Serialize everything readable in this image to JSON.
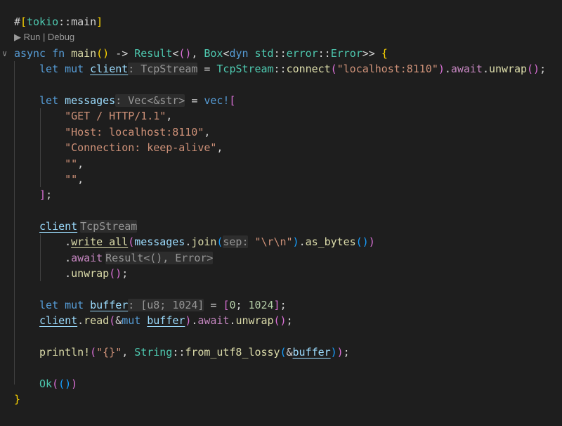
{
  "codelens": {
    "run": "Run",
    "sep": "|",
    "debug": "Debug"
  },
  "lines": [
    {
      "i": 0,
      "tokens": [
        {
          "c": "p",
          "t": "#"
        },
        {
          "c": "b1",
          "t": "["
        },
        {
          "c": "t",
          "t": "tokio"
        },
        {
          "c": "p",
          "t": "::"
        },
        {
          "c": "p",
          "t": "main"
        },
        {
          "c": "b1",
          "t": "]"
        }
      ]
    },
    {
      "lens": true
    },
    {
      "i": 0,
      "fold": true,
      "tokens": [
        {
          "c": "k",
          "t": "async"
        },
        {
          "c": "p",
          "t": " "
        },
        {
          "c": "k",
          "t": "fn"
        },
        {
          "c": "p",
          "t": " "
        },
        {
          "c": "f",
          "t": "main"
        },
        {
          "c": "b1",
          "t": "()"
        },
        {
          "c": "p",
          "t": " -> "
        },
        {
          "c": "t",
          "t": "Result"
        },
        {
          "c": "p",
          "t": "<"
        },
        {
          "c": "b2",
          "t": "()"
        },
        {
          "c": "p",
          "t": ", "
        },
        {
          "c": "t",
          "t": "Box"
        },
        {
          "c": "p",
          "t": "<"
        },
        {
          "c": "k",
          "t": "dyn"
        },
        {
          "c": "p",
          "t": " "
        },
        {
          "c": "t",
          "t": "std"
        },
        {
          "c": "p",
          "t": "::"
        },
        {
          "c": "t",
          "t": "error"
        },
        {
          "c": "p",
          "t": "::"
        },
        {
          "c": "t",
          "t": "Error"
        },
        {
          "c": "p",
          "t": ">> "
        },
        {
          "c": "b1",
          "t": "{"
        }
      ]
    },
    {
      "i": 4,
      "tokens": [
        {
          "c": "k",
          "t": "let"
        },
        {
          "c": "p",
          "t": " "
        },
        {
          "c": "k",
          "t": "mut"
        },
        {
          "c": "p",
          "t": " "
        },
        {
          "c": "v u",
          "t": "client"
        },
        {
          "c": "h",
          "t": ": TcpStream"
        },
        {
          "c": "p",
          "t": " = "
        },
        {
          "c": "t",
          "t": "TcpStream"
        },
        {
          "c": "p",
          "t": "::"
        },
        {
          "c": "f",
          "t": "connect"
        },
        {
          "c": "b2",
          "t": "("
        },
        {
          "c": "s",
          "t": "\"localhost:8110\""
        },
        {
          "c": "b2",
          "t": ")"
        },
        {
          "c": "p",
          "t": "."
        },
        {
          "c": "c",
          "t": "await"
        },
        {
          "c": "p",
          "t": "."
        },
        {
          "c": "f",
          "t": "unwrap"
        },
        {
          "c": "b2",
          "t": "()"
        },
        {
          "c": "p",
          "t": ";"
        }
      ]
    },
    {
      "i": 0,
      "tokens": []
    },
    {
      "i": 4,
      "tokens": [
        {
          "c": "k",
          "t": "let"
        },
        {
          "c": "p",
          "t": " "
        },
        {
          "c": "v",
          "t": "messages"
        },
        {
          "c": "h",
          "t": ": Vec<&str>"
        },
        {
          "c": "p",
          "t": " = "
        },
        {
          "c": "k",
          "t": "vec!"
        },
        {
          "c": "b2",
          "t": "["
        }
      ]
    },
    {
      "i": 8,
      "tokens": [
        {
          "c": "s",
          "t": "\"GET / HTTP/1.1\""
        },
        {
          "c": "p",
          "t": ","
        }
      ]
    },
    {
      "i": 8,
      "tokens": [
        {
          "c": "s",
          "t": "\"Host: localhost:8110\""
        },
        {
          "c": "p",
          "t": ","
        }
      ]
    },
    {
      "i": 8,
      "tokens": [
        {
          "c": "s",
          "t": "\"Connection: keep-alive\""
        },
        {
          "c": "p",
          "t": ","
        }
      ]
    },
    {
      "i": 8,
      "tokens": [
        {
          "c": "s",
          "t": "\"\""
        },
        {
          "c": "p",
          "t": ","
        }
      ]
    },
    {
      "i": 8,
      "tokens": [
        {
          "c": "s",
          "t": "\"\""
        },
        {
          "c": "p",
          "t": ","
        }
      ]
    },
    {
      "i": 4,
      "tokens": [
        {
          "c": "b2",
          "t": "]"
        },
        {
          "c": "p",
          "t": ";"
        }
      ]
    },
    {
      "i": 0,
      "tokens": []
    },
    {
      "i": 4,
      "tokens": [
        {
          "c": "v u",
          "t": "client"
        },
        {
          "c": "h hg",
          "t": "TcpStream"
        }
      ]
    },
    {
      "i": 8,
      "tokens": [
        {
          "c": "p",
          "t": "."
        },
        {
          "c": "f u",
          "t": "write_all"
        },
        {
          "c": "b2",
          "t": "("
        },
        {
          "c": "v",
          "t": "messages"
        },
        {
          "c": "p",
          "t": "."
        },
        {
          "c": "f",
          "t": "join"
        },
        {
          "c": "b3",
          "t": "("
        },
        {
          "c": "h",
          "t": "sep:"
        },
        {
          "c": "p",
          "t": " "
        },
        {
          "c": "s",
          "t": "\"\\r\\n\""
        },
        {
          "c": "b3",
          "t": ")"
        },
        {
          "c": "p",
          "t": "."
        },
        {
          "c": "f",
          "t": "as_bytes"
        },
        {
          "c": "b3",
          "t": "()"
        },
        {
          "c": "b2",
          "t": ")"
        }
      ]
    },
    {
      "i": 8,
      "tokens": [
        {
          "c": "p",
          "t": "."
        },
        {
          "c": "c",
          "t": "await"
        },
        {
          "c": "h hg",
          "t": "Result<(), Error>"
        }
      ]
    },
    {
      "i": 8,
      "tokens": [
        {
          "c": "p",
          "t": "."
        },
        {
          "c": "f",
          "t": "unwrap"
        },
        {
          "c": "b2",
          "t": "()"
        },
        {
          "c": "p",
          "t": ";"
        }
      ]
    },
    {
      "i": 0,
      "tokens": []
    },
    {
      "i": 4,
      "tokens": [
        {
          "c": "k",
          "t": "let"
        },
        {
          "c": "p",
          "t": " "
        },
        {
          "c": "k",
          "t": "mut"
        },
        {
          "c": "p",
          "t": " "
        },
        {
          "c": "v u",
          "t": "buffer"
        },
        {
          "c": "h",
          "t": ": [u8; 1024]"
        },
        {
          "c": "p",
          "t": " = "
        },
        {
          "c": "b2",
          "t": "["
        },
        {
          "c": "n",
          "t": "0"
        },
        {
          "c": "p",
          "t": "; "
        },
        {
          "c": "n",
          "t": "1024"
        },
        {
          "c": "b2",
          "t": "]"
        },
        {
          "c": "p",
          "t": ";"
        }
      ]
    },
    {
      "i": 4,
      "tokens": [
        {
          "c": "v u",
          "t": "client"
        },
        {
          "c": "p",
          "t": "."
        },
        {
          "c": "f",
          "t": "read"
        },
        {
          "c": "b2",
          "t": "("
        },
        {
          "c": "p",
          "t": "&"
        },
        {
          "c": "k",
          "t": "mut"
        },
        {
          "c": "p",
          "t": " "
        },
        {
          "c": "v u",
          "t": "buffer"
        },
        {
          "c": "b2",
          "t": ")"
        },
        {
          "c": "p",
          "t": "."
        },
        {
          "c": "c",
          "t": "await"
        },
        {
          "c": "p",
          "t": "."
        },
        {
          "c": "f",
          "t": "unwrap"
        },
        {
          "c": "b2",
          "t": "()"
        },
        {
          "c": "p",
          "t": ";"
        }
      ]
    },
    {
      "i": 0,
      "tokens": []
    },
    {
      "i": 4,
      "tokens": [
        {
          "c": "f",
          "t": "println!"
        },
        {
          "c": "b2",
          "t": "("
        },
        {
          "c": "s",
          "t": "\"{}\""
        },
        {
          "c": "p",
          "t": ", "
        },
        {
          "c": "t",
          "t": "String"
        },
        {
          "c": "p",
          "t": "::"
        },
        {
          "c": "f",
          "t": "from_utf8_lossy"
        },
        {
          "c": "b3",
          "t": "("
        },
        {
          "c": "p",
          "t": "&"
        },
        {
          "c": "v u",
          "t": "buffer"
        },
        {
          "c": "b3",
          "t": ")"
        },
        {
          "c": "b2",
          "t": ")"
        },
        {
          "c": "p",
          "t": ";"
        }
      ]
    },
    {
      "i": 0,
      "tokens": []
    },
    {
      "i": 4,
      "tokens": [
        {
          "c": "t",
          "t": "Ok"
        },
        {
          "c": "b2",
          "t": "("
        },
        {
          "c": "b3",
          "t": "()"
        },
        {
          "c": "b2",
          "t": ")"
        }
      ]
    },
    {
      "i": 0,
      "tokens": [
        {
          "c": "b1",
          "t": "}"
        }
      ]
    }
  ]
}
